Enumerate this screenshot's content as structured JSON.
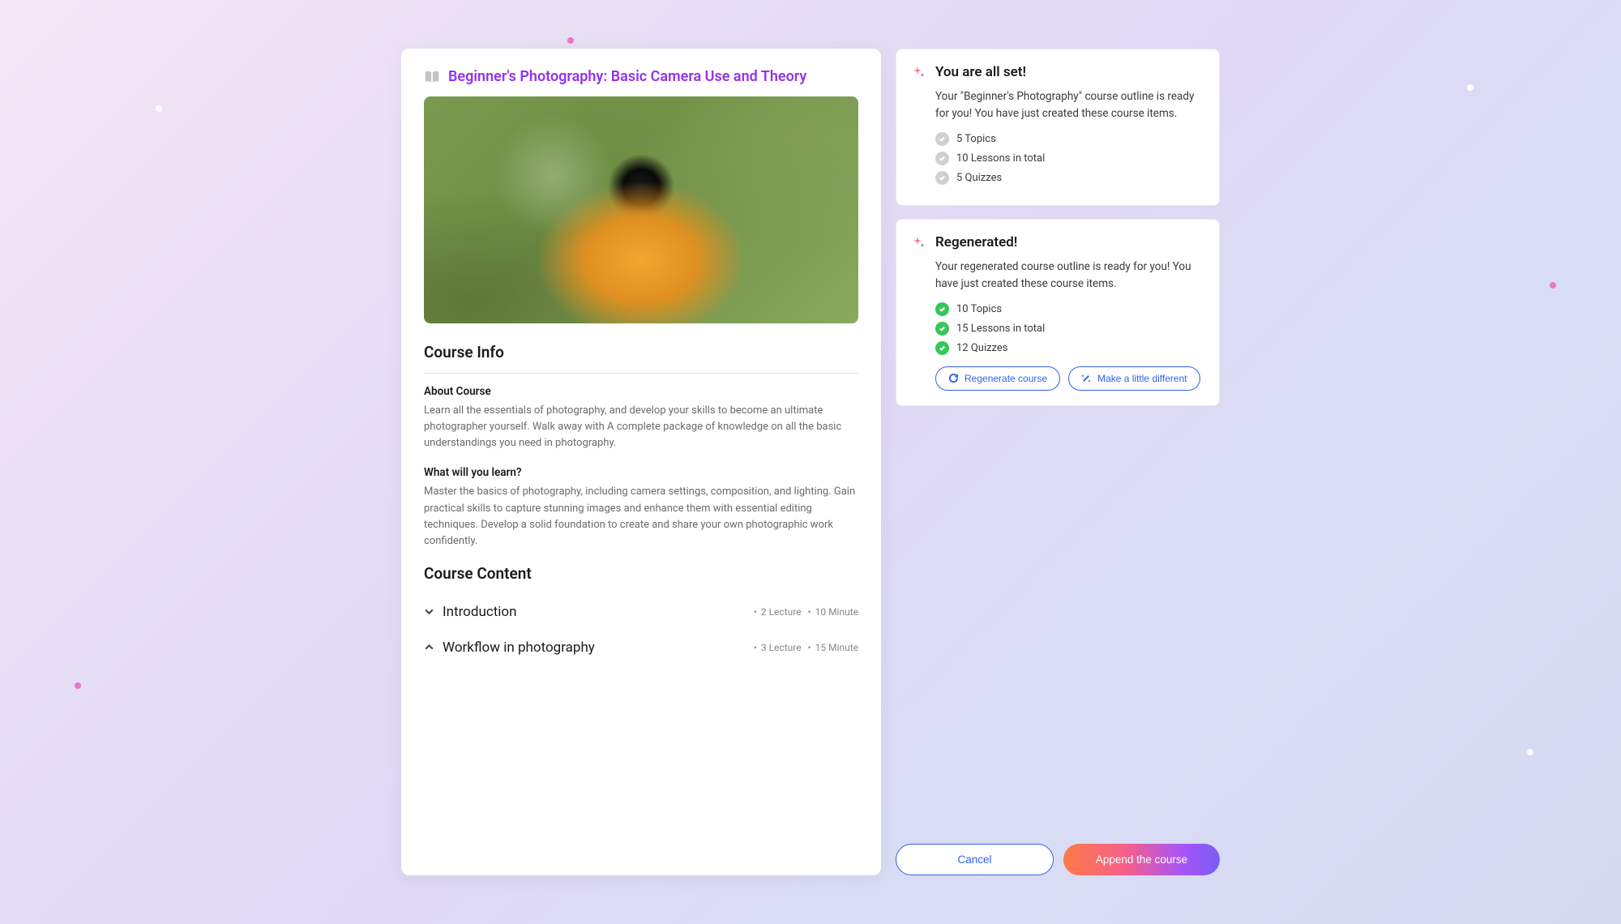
{
  "course": {
    "title": "Beginner's Photography: Basic Camera Use and Theory",
    "info_heading": "Course Info",
    "about_heading": "About Course",
    "about_text": "Learn all the essentials of photography, and develop your skills to become an ultimate photographer yourself. Walk away with A complete package of knowledge on all the basic understandings you need in photography.",
    "learn_heading": "What will you learn?",
    "learn_text": "Master the basics of photography, including camera settings, composition, and lighting. Gain practical skills to capture stunning images and enhance them with essential editing techniques. Develop a solid foundation to create and share your own photographic work confidently.",
    "content_heading": "Course Content",
    "items": [
      {
        "title": "Introduction",
        "lectures": "2 Lecture",
        "duration": "10 Minute",
        "expanded": false
      },
      {
        "title": "Workflow in photography",
        "lectures": "3 Lecture",
        "duration": "15 Minute",
        "expanded": true
      }
    ]
  },
  "status1": {
    "title": "You are all set!",
    "desc": "Your \"Beginner's Photography\" course outline is ready for you! You have just created these course items.",
    "checks": [
      "5 Topics",
      "10 Lessons in total",
      "5 Quizzes"
    ]
  },
  "status2": {
    "title": "Regenerated!",
    "desc": "Your regenerated course outline is ready for you! You have just created these course items.",
    "checks": [
      "10 Topics",
      "15 Lessons in total",
      "12 Quizzes"
    ],
    "regenerate_label": "Regenerate course",
    "different_label": "Make a little different"
  },
  "footer": {
    "cancel": "Cancel",
    "append": "Append the course"
  }
}
